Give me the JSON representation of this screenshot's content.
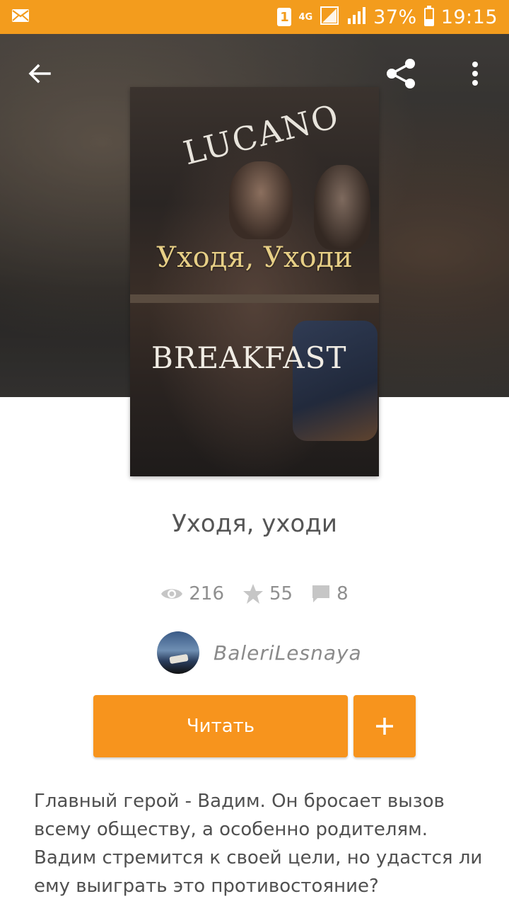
{
  "status_bar": {
    "sim_slot": "1",
    "network": "4G",
    "battery": "37%",
    "time": "19:15",
    "icons": [
      "mail-icon",
      "signal-icon",
      "battery-icon"
    ]
  },
  "toolbar": {
    "back_icon": "arrow-back-icon",
    "share_icon": "share-icon",
    "more_icon": "more-vert-icon"
  },
  "cover": {
    "sign_top": "LUCANO",
    "title": "Уходя, Уходи",
    "sign_bottom": "BREAKFAST"
  },
  "book": {
    "title": "Уходя, уходи",
    "stats": {
      "views": "216",
      "votes": "55",
      "comments": "8"
    },
    "author": "BaleriLesnaya"
  },
  "actions": {
    "read_label": "Читать",
    "add_label": "+"
  },
  "description": "Главный герой - Вадим. Он бросает вызов всему обществу, а особенно родителям. Вадим стремится к своей цели, но удастся ли ему выиграть это противостояние?",
  "colors": {
    "accent": "#f7941d",
    "status_bar": "#f39c1d"
  }
}
